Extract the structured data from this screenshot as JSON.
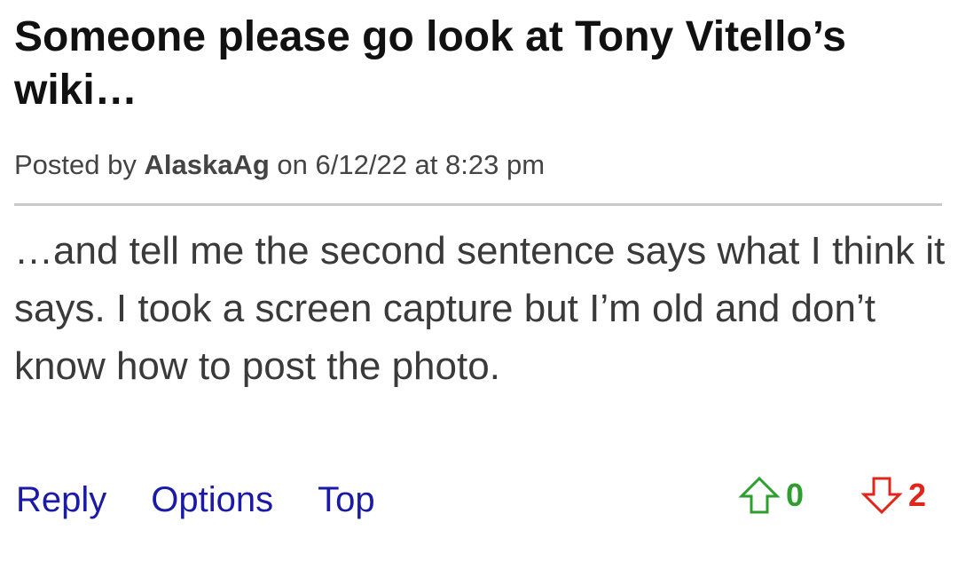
{
  "post": {
    "title": "Someone please go look at Tony Vitello’s wiki…",
    "meta": {
      "prefix": "Posted by ",
      "author": "AlaskaAg",
      "infix": " on ",
      "datetime": "6/12/22 at 8:23 pm"
    },
    "body": "…and tell me the second sentence says what I think it says. I took a screen capture but I’m old and don’t know how to post the photo.",
    "actions": {
      "reply": "Reply",
      "options": "Options",
      "top": "Top"
    },
    "votes": {
      "up_count": "0",
      "down_count": "2",
      "up_icon": "arrow-up-outline-icon",
      "down_icon": "arrow-down-outline-icon",
      "up_color": "#2e9e2e",
      "down_color": "#e0251b"
    }
  },
  "colors": {
    "link": "#1a1aa6",
    "title": "#111111",
    "body_text": "#3a3a3a",
    "divider": "#c9c9c9"
  }
}
